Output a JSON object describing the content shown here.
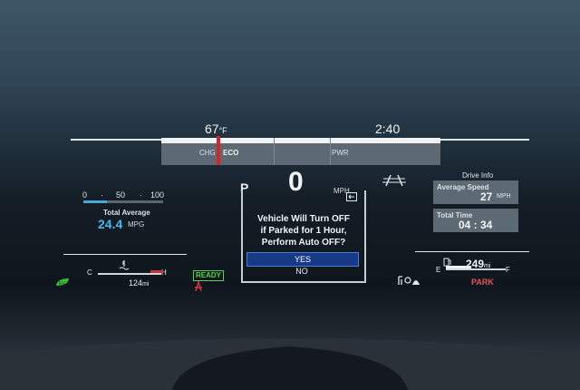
{
  "top_bar": {
    "temperature": "67",
    "temp_unit": "°F",
    "time": "2:40",
    "chg_label": "CHG",
    "eco_label": "ECO",
    "pwr_label": "PWR"
  },
  "speed": {
    "value": "0",
    "unit": "MPH",
    "gear": "P"
  },
  "left_panel": {
    "scale_0": "0",
    "scale_50": "50",
    "scale_100": "100",
    "total_average_label": "Total Average",
    "mpg_value": "24.4",
    "mpg_unit": "MPG",
    "temp_c": "C",
    "temp_h": "H",
    "range_value": "124",
    "range_unit": "mi",
    "ready_label": "READY"
  },
  "message": {
    "line1": "Vehicle Will Turn OFF",
    "line2": "if Parked for 1 Hour,",
    "line3": "Perform Auto OFF?",
    "yes_label": "YES",
    "no_label": "NO"
  },
  "right_panel": {
    "drive_info_label": "Drive Info",
    "avg_speed_label": "Average Speed",
    "avg_speed_value": "27",
    "avg_speed_unit": "MPH",
    "total_time_label": "Total Time",
    "total_time_value": "04 : 34",
    "fuel_range_value": "249",
    "fuel_range_unit": "mi",
    "fuel_e": "E",
    "fuel_f": "F",
    "park_label": "PARK"
  },
  "colors": {
    "eco_marker": "#d4232d",
    "mpg": "#4fb4e6",
    "ready": "#57d24a",
    "park": "#e2545b",
    "yes_highlight": "#173a86"
  },
  "icons": [
    "eco-leaf-icon",
    "coolant-temp-icon",
    "hybrid-warning-icon",
    "fuel-pump-icon",
    "lane-assist-icon",
    "door-open-icon",
    "driver-assist-icon"
  ]
}
